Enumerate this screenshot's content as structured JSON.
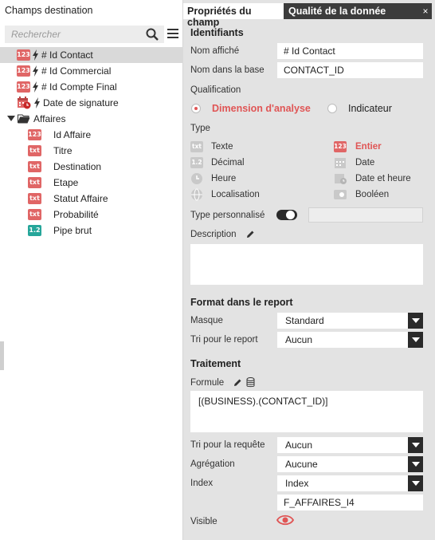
{
  "left_panel": {
    "title": "Champs destination",
    "search_placeholder": "Rechercher",
    "tree": [
      {
        "badge": "123",
        "label": "# Id Contact",
        "selected": true
      },
      {
        "badge": "123",
        "label": "# Id Commercial"
      },
      {
        "badge": "123",
        "label": "# Id Compte Final"
      },
      {
        "badge": "date",
        "label": "Date de signature"
      },
      {
        "label": "Affaires"
      },
      {
        "badge": "123",
        "label": "Id Affaire"
      },
      {
        "badge": "txt",
        "label": "Titre"
      },
      {
        "badge": "txt",
        "label": "Destination"
      },
      {
        "badge": "txt",
        "label": "Etape"
      },
      {
        "badge": "txt",
        "label": "Statut Affaire"
      },
      {
        "badge": "txt",
        "label": "Probabilité"
      },
      {
        "badge": "1.2",
        "label": "Pipe brut"
      }
    ]
  },
  "right_panel": {
    "tabs": {
      "properties": "Propriétés du champ",
      "quality": "Qualité de la donnée",
      "close": "×"
    },
    "identifiants": {
      "section": "Identifiants",
      "nom_affiche_label": "Nom affiché",
      "nom_affiche_value": "# Id Contact",
      "nom_base_label": "Nom dans la base",
      "nom_base_value": "CONTACT_ID",
      "qualification_label": "Qualification",
      "dimension": "Dimension d'analyse",
      "indicateur": "Indicateur",
      "type_label": "Type",
      "types": {
        "texte": "Texte",
        "decimal": "Décimal",
        "heure": "Heure",
        "localisation": "Localisation",
        "entier": "Entier",
        "date": "Date",
        "date_heure": "Date et heure",
        "booleen": "Booléen"
      },
      "type_badges": {
        "texte": "txt",
        "decimal": "1.2",
        "entier": "123"
      },
      "type_perso_label": "Type personnalisé",
      "description_label": "Description"
    },
    "format": {
      "section": "Format dans le report",
      "masque_label": "Masque",
      "masque_value": "Standard",
      "tri_report_label": "Tri pour le report",
      "tri_report_value": "Aucun"
    },
    "traitement": {
      "section": "Traitement",
      "formule_label": "Formule",
      "formule_value": "[(BUSINESS).(CONTACT_ID)]",
      "tri_requete_label": "Tri pour la requête",
      "tri_requete_value": "Aucun",
      "agregation_label": "Agrégation",
      "agregation_value": "Aucune",
      "index_label": "Index",
      "index_value": "Index",
      "index_name": "F_AFFAIRES_I4",
      "visible_label": "Visible"
    }
  },
  "colors": {
    "accent": "#e05555",
    "int_badge": "#e06666",
    "dec_badge": "#26a69a",
    "tab_dark": "#3c3c3c"
  }
}
